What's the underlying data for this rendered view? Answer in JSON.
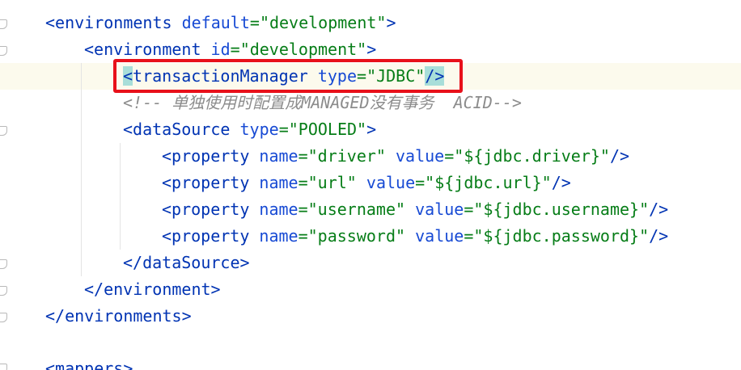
{
  "editor": {
    "lines": [
      {
        "open": "<",
        "tag": "environments",
        "attr1": "default",
        "eq1": "=",
        "val1": "\"development\"",
        "close": ">"
      },
      {
        "open": "<",
        "tag": "environment",
        "attr1": "id",
        "eq1": "=",
        "val1": "\"development\"",
        "close": ">"
      },
      {
        "open": "<",
        "tag": "transactionManager",
        "attr1": "type",
        "eq1": "=",
        "val1": "\"JDBC\"",
        "close": "/>"
      },
      {
        "comment": "<!-- 单独使用时配置成MANAGED没有事务  ACID-->"
      },
      {
        "open": "<",
        "tag": "dataSource",
        "attr1": "type",
        "eq1": "=",
        "val1": "\"POOLED\"",
        "close": ">"
      },
      {
        "open": "<",
        "tag": "property",
        "attr1": "name",
        "eq1": "=",
        "val1": "\"driver\"",
        "attr2": "value",
        "eq2": "=",
        "val2": "\"${jdbc.driver}\"",
        "close": "/>"
      },
      {
        "open": "<",
        "tag": "property",
        "attr1": "name",
        "eq1": "=",
        "val1": "\"url\"",
        "attr2": "value",
        "eq2": "=",
        "val2": "\"${jdbc.url}\"",
        "close": "/>"
      },
      {
        "open": "<",
        "tag": "property",
        "attr1": "name",
        "eq1": "=",
        "val1": "\"username\"",
        "attr2": "value",
        "eq2": "=",
        "val2": "\"${jdbc.username}\"",
        "close": "/>"
      },
      {
        "open": "<",
        "tag": "property",
        "attr1": "name",
        "eq1": "=",
        "val1": "\"password\"",
        "attr2": "value",
        "eq2": "=",
        "val2": "\"${jdbc.password}\"",
        "close": "/>"
      },
      {
        "open": "</",
        "tag": "dataSource",
        "close": ">"
      },
      {
        "open": "</",
        "tag": "environment",
        "close": ">"
      },
      {
        "open": "</",
        "tag": "environments",
        "close": ">"
      },
      {
        "open": "<",
        "tag": "mappers",
        "close": ">"
      }
    ]
  },
  "colors": {
    "tag": "#0033b3",
    "attribute": "#174ad4",
    "value": "#067d17",
    "comment": "#8c8c8c",
    "bracket_highlight": "#a8ded9",
    "caret_row": "#fcfaed",
    "annotation_box": "#e8101a"
  }
}
